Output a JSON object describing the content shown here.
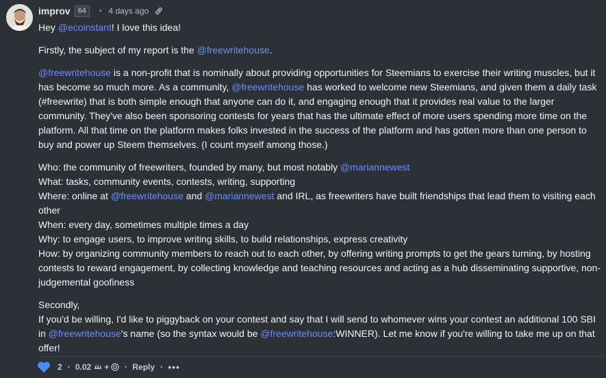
{
  "comment": {
    "author": "improv",
    "reputation": "64",
    "separator": "•",
    "timestamp": "4 days ago",
    "avatar_icon": "avatar-photo",
    "link_icon": "link-icon",
    "colors": {
      "background": "#2c3136",
      "mention": "#6a8cff",
      "heart": "#4a8cf7"
    }
  },
  "body": {
    "p1": {
      "t1": "Hey ",
      "m1": "@ecoinstant",
      "t2": "! I love this idea!"
    },
    "p2": {
      "t1": "Firstly, the subject of my report is the ",
      "m1": "@freewritehouse",
      "t2": "."
    },
    "p3": {
      "m1": "@freewritehouse",
      "t1": " is a non-profit that is nominally about providing opportunities for Steemians to exercise their writing muscles, but it has become so much more. As a community, ",
      "m2": "@freewritehouse",
      "t2": " has worked to welcome new Steemians, and given them a daily task (#freewrite) that is both simple enough that anyone can do it, and engaging enough that it provides real value to the larger community. They've also been sponsoring contests for years that has the ultimate effect of more users spending more time on the platform. All that time on the platform makes folks invested in the success of the platform and has gotten more than one person to buy and power up Steem themselves. (I count myself among those.)"
    },
    "p4": {
      "who_t": "Who: the community of freewriters, founded by many, but most notably ",
      "who_m": "@mariannewest",
      "what": "What: tasks, community events, contests, writing, supporting",
      "where_t1": "Where: online at ",
      "where_m1": "@freewritehouse",
      "where_t2": " and ",
      "where_m2": "@mariannewest",
      "where_t3": " and IRL, as freewriters have built friendships that lead them to visiting each other",
      "when": "When: every day, sometimes multiple times a day",
      "why": "Why: to engage users, to improve writing skills, to build relationships, express creativity",
      "how": "How: by organizing community members to reach out to each other, by offering writing prompts to get the gears turning, by hosting contests to reward engagement, by collecting knowledge and teaching resources and acting as a hub disseminating supportive, non-judgemental goofiness"
    },
    "p5": {
      "secondly": "Secondly,",
      "t1": "If you'd be willing, I'd like to piggyback on your contest and say that I will send to whomever wins your contest an additional 100 SBI in ",
      "m1": "@freewritehouse",
      "t2": "'s name (so the syntax would be ",
      "m2": "@freewritehouse",
      "t3": ":WINNER). Let me know if you're willing to take me up on that offer!"
    }
  },
  "footer": {
    "heart_icon": "heart-icon",
    "votes": "2",
    "sep": "•",
    "payout": "0.02",
    "steem_icon": "steem-icon",
    "plus": "+",
    "sp_icon": "steem-power-icon",
    "reply": "Reply",
    "more": "•••"
  }
}
